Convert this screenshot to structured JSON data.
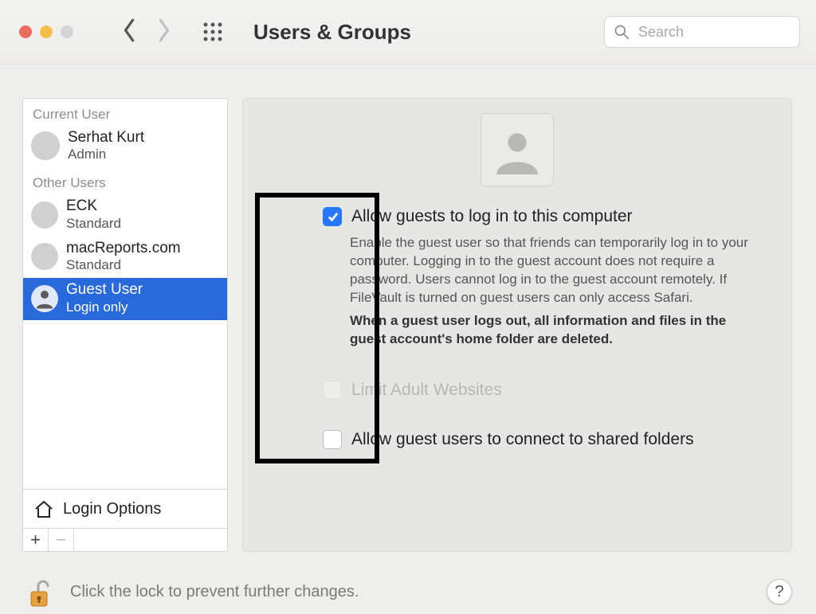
{
  "window": {
    "title": "Users & Groups"
  },
  "search": {
    "placeholder": "Search",
    "value": ""
  },
  "sidebar": {
    "sections": {
      "current_label": "Current User",
      "other_label": "Other Users"
    },
    "current": {
      "name": "Serhat Kurt",
      "role": "Admin"
    },
    "others": [
      {
        "name": "ECK",
        "role": "Standard"
      },
      {
        "name": "macReports.com",
        "role": "Standard"
      },
      {
        "name": "Guest User",
        "role": "Login only"
      }
    ],
    "login_options": "Login Options"
  },
  "detail": {
    "opt1": {
      "label": "Allow guests to log in to this computer",
      "desc": "Enable the guest user so that friends can temporarily log in to your computer. Logging in to the guest account does not require a password. Users cannot log in to the guest account remotely. If FileVault is turned on guest users can only access Safari.",
      "desc_bold": "When a guest user logs out, all information and files in the guest account's home folder are deleted.",
      "checked": true
    },
    "opt2": {
      "label": "Limit Adult Websites",
      "checked": false,
      "disabled": true
    },
    "opt3": {
      "label": "Allow guest users to connect to shared folders",
      "checked": false
    }
  },
  "footer": {
    "message": "Click the lock to prevent further changes."
  }
}
